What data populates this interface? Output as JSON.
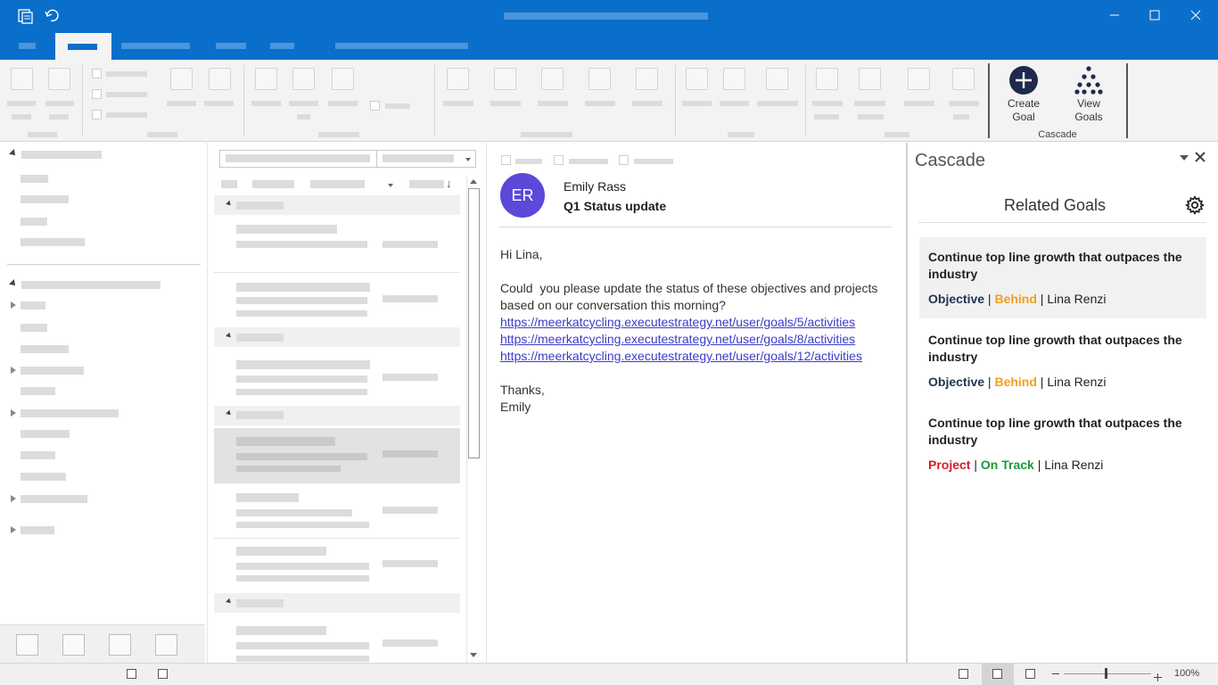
{
  "ribbon": {
    "cascade_group": {
      "label": "Cascade",
      "create_goal_label_line1": "Create",
      "create_goal_label_line2": "Goal",
      "view_goals_label_line1": "View",
      "view_goals_label_line2": "Goals"
    }
  },
  "email": {
    "avatar_initials": "ER",
    "sender": "Emily Rass",
    "subject": "Q1 Status update",
    "greeting": "Hi Lina,",
    "body_line1": "Could  you please update the status of these objectives and projects",
    "body_line2": "based on our conversation this morning?",
    "links": [
      "https://meerkatcycling.executestrategy.net/user/goals/5/activities",
      "https://meerkatcycling.executestrategy.net/user/goals/8/activities",
      "https://meerkatcycling.executestrategy.net/user/goals/12/activities"
    ],
    "closing": "Thanks,",
    "signature": "Emily"
  },
  "cascade_pane": {
    "title": "Cascade",
    "section_title": "Related Goals",
    "goals": [
      {
        "title": "Continue top line growth that outpaces the industry",
        "type": "Objective",
        "status": "Behind",
        "owner": "Lina Renzi"
      },
      {
        "title": "Continue top line growth that outpaces the industry",
        "type": "Objective",
        "status": "Behind",
        "owner": "Lina Renzi"
      },
      {
        "title": "Continue top line growth that outpaces the industry",
        "type": "Project",
        "status": "On Track",
        "owner": "Lina Renzi"
      }
    ],
    "separator": "|"
  },
  "statusbar": {
    "zoom": "100%"
  },
  "colors": {
    "title_bar": "#0a6ecb",
    "objective": "#22364f",
    "behind": "#f0a020",
    "project": "#d0202a",
    "on_track": "#1a9a3a",
    "avatar": "#5c48d9",
    "link": "#3b3bcc"
  }
}
